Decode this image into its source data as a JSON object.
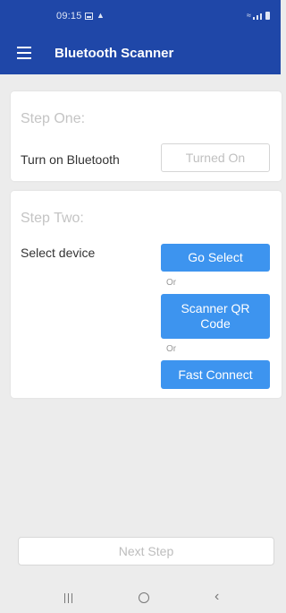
{
  "status_bar": {
    "time": "09:15"
  },
  "app_bar": {
    "title": "Bluetooth Scanner"
  },
  "step_one": {
    "title": "Step One:",
    "label": "Turn on Bluetooth",
    "button": "Turned On"
  },
  "step_two": {
    "title": "Step Two:",
    "label": "Select device",
    "go_select": "Go Select",
    "or_1": "Or",
    "scanner_qr": "Scanner QR Code",
    "or_2": "Or",
    "fast_connect": "Fast Connect"
  },
  "footer": {
    "next_step": "Next Step"
  },
  "colors": {
    "primary": "#1f47a8",
    "accent": "#3d94ef",
    "background": "#ececec"
  }
}
